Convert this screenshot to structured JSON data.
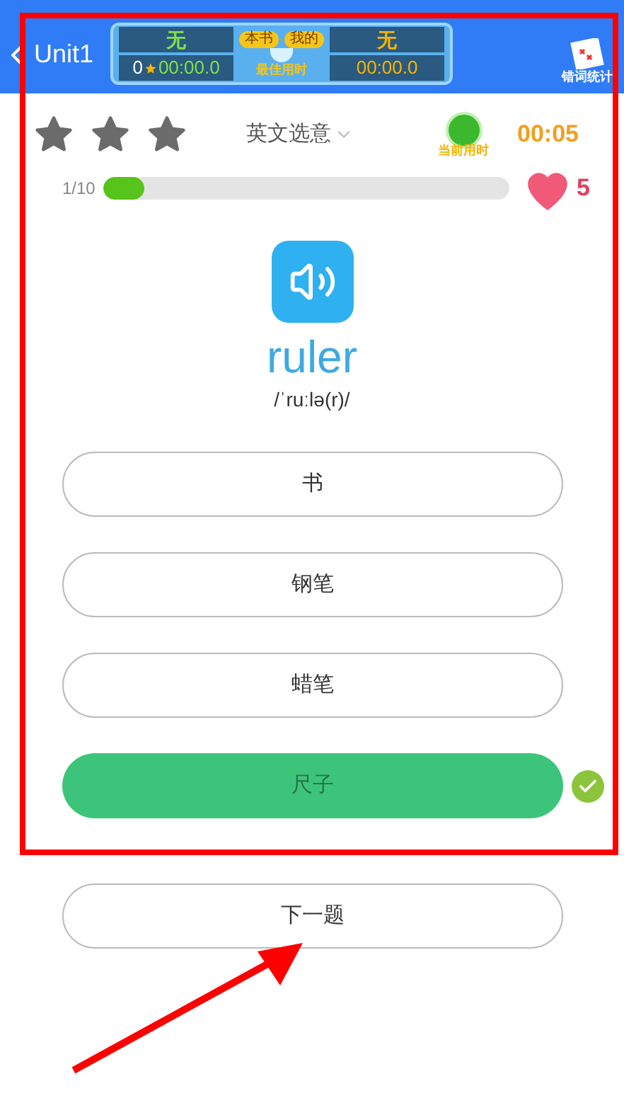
{
  "header": {
    "back_label": "Unit1",
    "best": {
      "left_value": "无",
      "left_count": "0",
      "left_time": "00:00.0",
      "badge_left": "本书",
      "badge_right": "我的",
      "label": "最佳用时",
      "right_value": "无",
      "right_time": "00:00.0"
    },
    "stats_label": "错词统计"
  },
  "toolbar": {
    "mode": "英文选意",
    "timer_label": "当前用时",
    "timer": "00:05"
  },
  "progress": {
    "count": "1/10",
    "level": 0.1,
    "lives": "5"
  },
  "word": {
    "text": "ruler",
    "phonetic": "/ˈruːlə(r)/"
  },
  "options": [
    {
      "label": "书",
      "correct": false
    },
    {
      "label": "钢笔",
      "correct": false
    },
    {
      "label": "蜡笔",
      "correct": false
    },
    {
      "label": "尺子",
      "correct": true
    }
  ],
  "next_button": "下一题"
}
